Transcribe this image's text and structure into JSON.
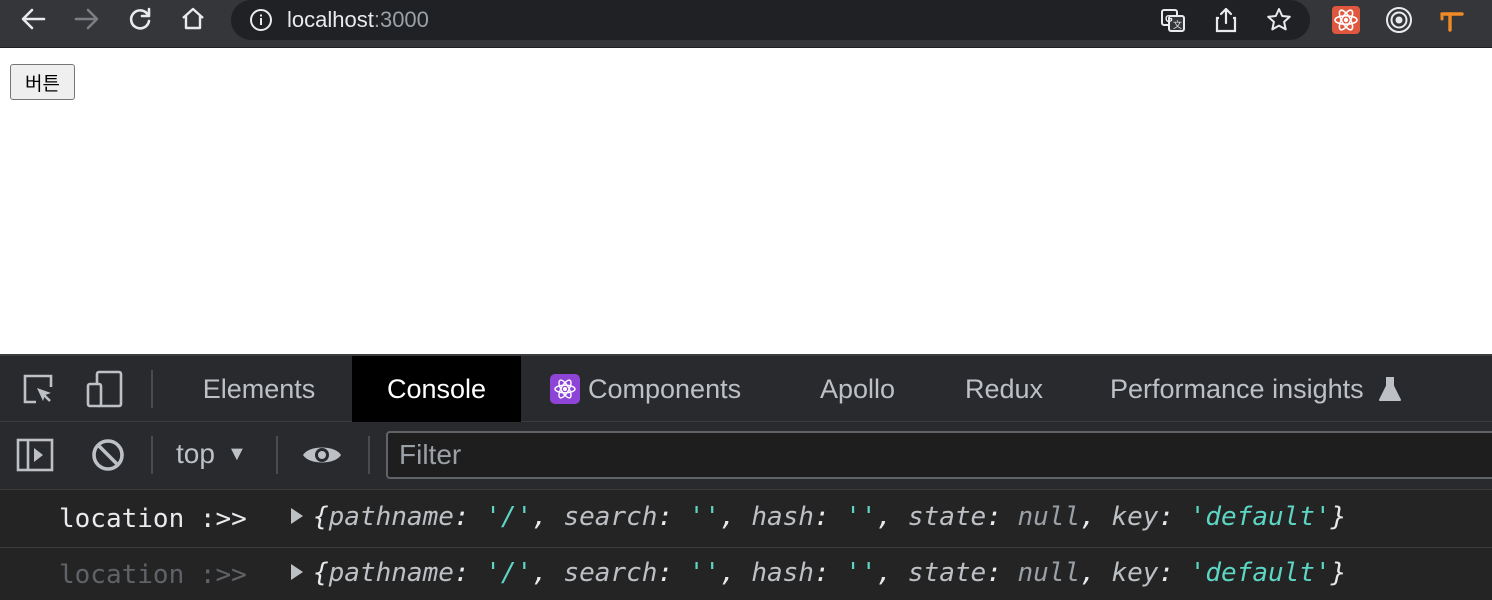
{
  "browser": {
    "url_host": "localhost",
    "url_port": ":3000",
    "icons": [
      "back-icon",
      "forward-icon",
      "reload-icon",
      "home-icon",
      "site-info-icon",
      "translate-icon",
      "share-icon",
      "bookmark-star-icon",
      "react-devtools-extension-icon",
      "target-extension-icon",
      "wappalyzer-extension-icon"
    ]
  },
  "page": {
    "button_label": "버튼"
  },
  "devtools": {
    "tabs": {
      "elements": "Elements",
      "console": "Console",
      "components": "Components",
      "apollo": "Apollo",
      "redux": "Redux",
      "performance_insights": "Performance insights"
    },
    "active_tab": "Console",
    "context": "top",
    "filter_placeholder": "Filter",
    "logs": [
      {
        "label": "location :>>",
        "pathname_key": "pathname",
        "pathname_val": "'/'",
        "search_key": "search",
        "search_val": "''",
        "hash_key": "hash",
        "hash_val": "''",
        "state_key": "state",
        "state_val": "null",
        "key_key": "key",
        "key_val": "'default'"
      },
      {
        "label": "location :>>",
        "pathname_key": "pathname",
        "pathname_val": "'/'",
        "search_key": "search",
        "search_val": "''",
        "hash_key": "hash",
        "hash_val": "''",
        "state_key": "state",
        "state_val": "null",
        "key_key": "key",
        "key_val": "'default'"
      }
    ]
  },
  "colors": {
    "toolbar_bg": "#35363a",
    "omnibox_bg": "#202124",
    "devtools_bg": "#242424",
    "string_color": "#5cd5c3",
    "react_badge": "#8e44d6"
  }
}
